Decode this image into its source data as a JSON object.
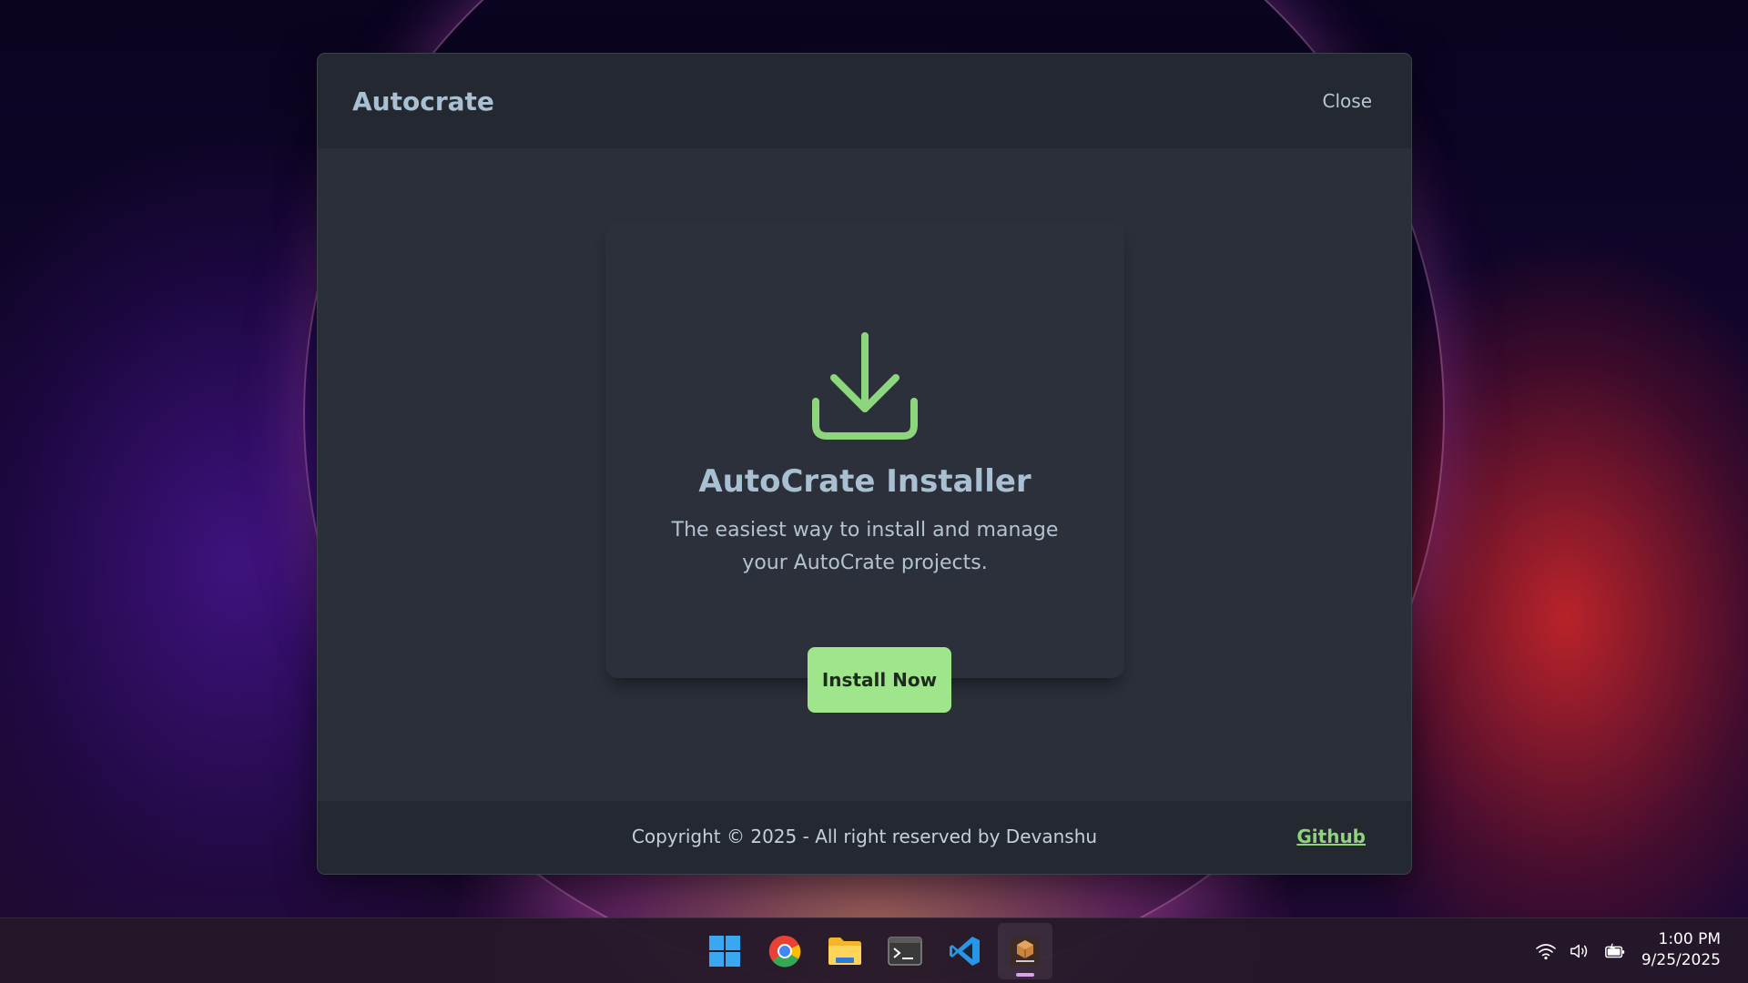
{
  "dialog": {
    "title": "Autocrate",
    "close_label": "Close",
    "card": {
      "icon": "download-icon",
      "title": "AutoCrate Installer",
      "description": "The easiest way to install and manage your AutoCrate projects.",
      "install_label": "Install Now"
    },
    "footer": {
      "copyright": "Copyright © 2025 - All right reserved by Devanshu",
      "github_label": "Github"
    }
  },
  "colors": {
    "accent": "#9fe58c",
    "link": "#8fd37c",
    "dialog_bg": "#2a2f38",
    "header_bg": "#232831",
    "title_text": "#a9c0d2"
  },
  "taskbar": {
    "apps": [
      {
        "name": "start",
        "icon": "windows-start-icon"
      },
      {
        "name": "chrome",
        "icon": "chrome-icon"
      },
      {
        "name": "file-explorer",
        "icon": "folder-icon"
      },
      {
        "name": "terminal",
        "icon": "terminal-icon"
      },
      {
        "name": "vscode",
        "icon": "vscode-icon"
      },
      {
        "name": "autocrate",
        "icon": "autocrate-icon",
        "active": true
      }
    ],
    "tray": [
      "wifi-icon",
      "volume-icon",
      "battery-icon"
    ],
    "time": "1:00 PM",
    "date": "9/25/2025"
  }
}
